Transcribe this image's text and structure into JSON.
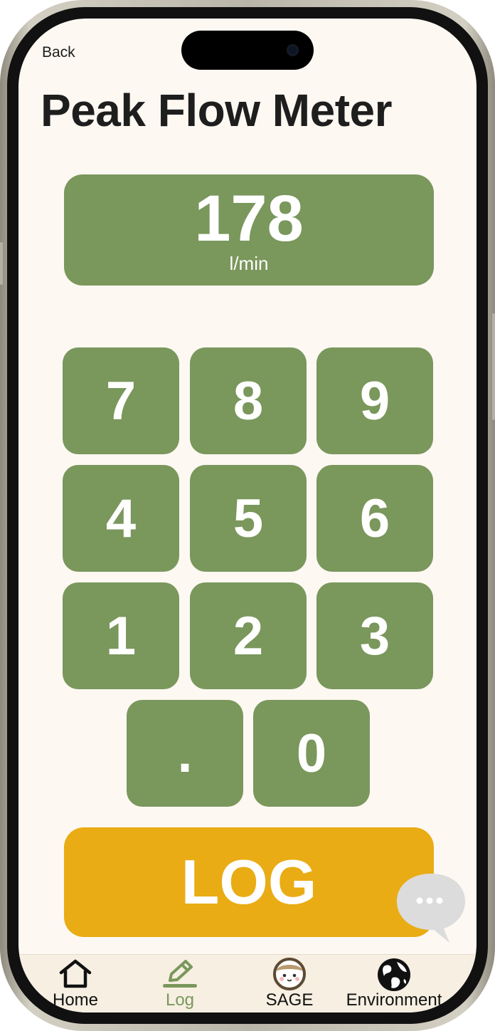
{
  "nav": {
    "back_label": "Back"
  },
  "page": {
    "title": "Peak Flow Meter"
  },
  "reading": {
    "value": "178",
    "unit": "l/min"
  },
  "keypad": {
    "keys": [
      "7",
      "8",
      "9",
      "4",
      "5",
      "6",
      "1",
      "2",
      "3",
      ".",
      "0"
    ]
  },
  "actions": {
    "log_label": "LOG"
  },
  "colors": {
    "key_green": "#7a975c",
    "log_yellow": "#e9ac14",
    "background": "#fdf8f2",
    "tab_active": "#7a975c"
  },
  "tabbar": {
    "tabs": [
      {
        "label": "Home",
        "icon": "home-icon",
        "active": false
      },
      {
        "label": "Log",
        "icon": "pencil-icon",
        "active": true
      },
      {
        "label": "SAGE",
        "icon": "sage-avatar-icon",
        "active": false
      },
      {
        "label": "Environment",
        "icon": "globe-icon",
        "active": false
      }
    ]
  },
  "chat": {
    "icon": "chat-bubble-icon"
  }
}
